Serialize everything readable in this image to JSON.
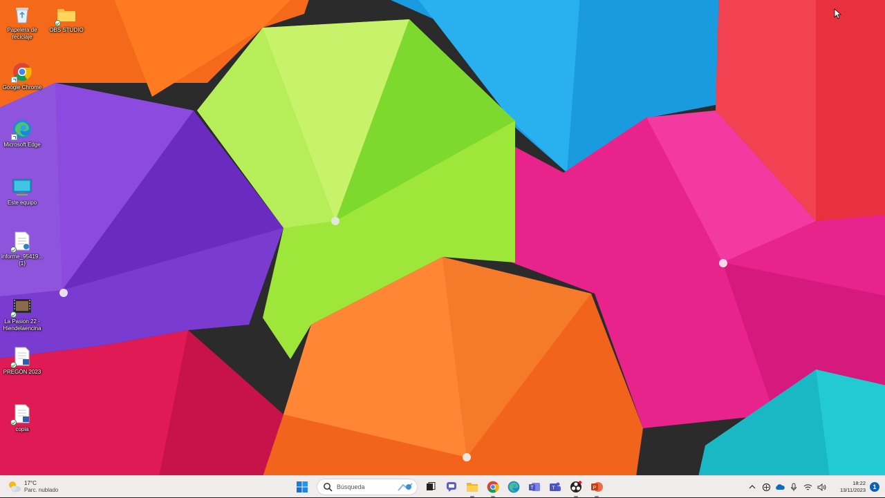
{
  "desktop": {
    "icons": [
      {
        "label": "Papelera de reciclaje",
        "icon": "recycle-bin-icon"
      },
      {
        "label": "OBS STUDIO",
        "icon": "folder-icon"
      },
      {
        "label": "Google Chrome",
        "icon": "chrome-icon"
      },
      {
        "label": "Microsoft Edge",
        "icon": "edge-icon"
      },
      {
        "label": "Este equipo",
        "icon": "computer-icon"
      },
      {
        "label": "informe_95419... (1)",
        "icon": "document-icon"
      },
      {
        "label": "La Pasion 22 - Hiendelaencina",
        "icon": "video-file-icon"
      },
      {
        "label": "PREGÓN 2023",
        "icon": "word-document-icon"
      },
      {
        "label": "copia",
        "icon": "word-document-icon"
      }
    ]
  },
  "taskbar": {
    "weather": {
      "temp": "17°C",
      "condition": "Parc. nublado",
      "icon": "partly-cloudy-icon"
    },
    "search_placeholder": "Búsqueda",
    "pinned": [
      "start-icon",
      "search-icon",
      "task-view-icon",
      "chat-icon",
      "file-explorer-icon",
      "chrome-icon",
      "edge-icon",
      "teams-classic-icon",
      "teams-icon",
      "obs-icon",
      "powerpoint-icon"
    ],
    "tray": [
      "chevron-up-icon",
      "network-sync-icon",
      "onedrive-icon",
      "microphone-icon",
      "wifi-icon",
      "volume-icon"
    ],
    "clock": {
      "time": "18:22",
      "date": "13/11/2023"
    },
    "notification_count": "1"
  },
  "colors": {
    "taskbar_bg": "#f1ecec",
    "accent": "#0078d4"
  }
}
